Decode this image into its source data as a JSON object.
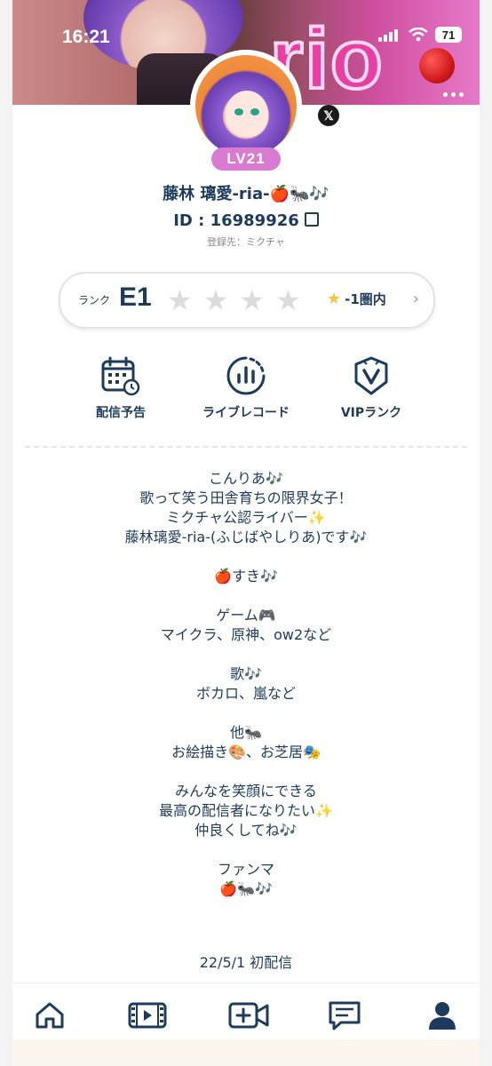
{
  "status_bar": {
    "time": "16:21",
    "battery": "71"
  },
  "profile": {
    "level": "LV21",
    "social": "𝕏",
    "name": "藤林 璃愛-ria-🍎🐜🎶",
    "user_id": "ID : 16989926",
    "registered": "登録先：ミクチャ"
  },
  "cover": {
    "logo_text": "rio"
  },
  "rank": {
    "label": "ランク",
    "value": "E1",
    "stars_filled": 0,
    "stars_total": 4,
    "circle_text": "-1圏内"
  },
  "actions": [
    {
      "label": "配信予告",
      "icon": "calendar-clock-icon"
    },
    {
      "label": "ライブレコード",
      "icon": "bar-chart-circle-icon"
    },
    {
      "label": "VIPランク",
      "icon": "vip-badge-icon"
    }
  ],
  "bio": [
    "こんりあ🎶",
    "歌って笑う田舎育ちの限界女子！",
    "ミクチャ公認ライバー✨",
    "藤林璃愛-ria-(ふじばやしりあ)です🎶",
    "",
    "🍎すき🎶",
    "",
    "ゲーム🎮",
    "マイクラ、原神、ow2など",
    "",
    "歌🎶",
    "ボカロ、嵐など",
    "",
    "他🐜",
    "お絵描き🎨、お芝居🎭",
    "",
    "みんなを笑顔にできる",
    "最高の配信者になりたい✨",
    "仲良くしてね🎶",
    "",
    "ファンマ",
    "🍎🐜🎶"
  ],
  "debut": "22/5/1 初配信",
  "tabs": [
    {
      "name": "home",
      "icon": "home-icon"
    },
    {
      "name": "videos",
      "icon": "film-icon"
    },
    {
      "name": "go-live",
      "icon": "add-video-icon"
    },
    {
      "name": "messages",
      "icon": "chat-icon"
    },
    {
      "name": "profile",
      "icon": "person-icon"
    }
  ]
}
